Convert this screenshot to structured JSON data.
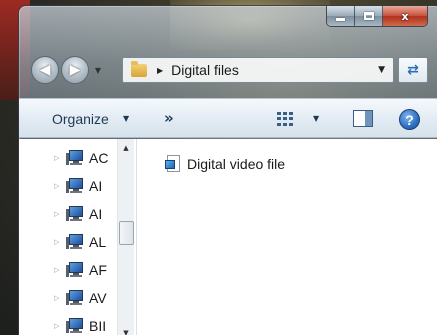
{
  "window": {
    "caption": {
      "minimize": "minimize",
      "maximize": "maximize",
      "close": "x"
    }
  },
  "address_bar": {
    "breadcrumb": "Digital files"
  },
  "toolbar": {
    "organize_label": "Organize",
    "more_label": "»"
  },
  "navigation_pane": {
    "items": [
      {
        "label": "AC"
      },
      {
        "label": "AI"
      },
      {
        "label": "AI"
      },
      {
        "label": "AL"
      },
      {
        "label": "AF"
      },
      {
        "label": "AV"
      },
      {
        "label": "BII"
      }
    ]
  },
  "files": [
    {
      "name": "Digital video file",
      "icon": "video-file-icon"
    }
  ],
  "colors": {
    "toolbar_text": "#1e3954",
    "help_blue": "#2e6fc0",
    "close_red": "#c8553f"
  }
}
